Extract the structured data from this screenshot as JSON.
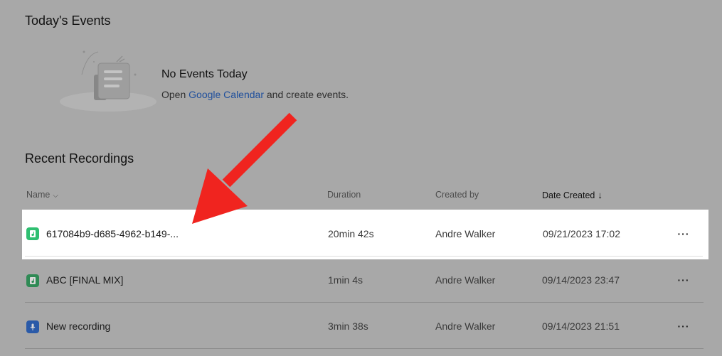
{
  "today": {
    "title": "Today's Events",
    "empty_title": "No Events Today",
    "empty_text_before": "Open ",
    "empty_link": "Google Calendar",
    "empty_text_after": " and create events."
  },
  "recent": {
    "title": "Recent Recordings",
    "columns": {
      "name": "Name",
      "duration": "Duration",
      "created_by": "Created by",
      "date_created": "Date Created"
    },
    "rows": [
      {
        "name": "617084b9-d685-4962-b149-...",
        "duration": "20min 42s",
        "created_by": "Andre Walker",
        "date": "09/21/2023 17:02",
        "icon": "audio-file-icon",
        "icon_color": "#2fbf71",
        "highlighted": true
      },
      {
        "name": "ABC [FINAL MIX]",
        "duration": "1min 4s",
        "created_by": "Andre Walker",
        "date": "09/14/2023 23:47",
        "icon": "audio-file-icon",
        "icon_color": "#2f8a55",
        "highlighted": false
      },
      {
        "name": "New recording",
        "duration": "3min 38s",
        "created_by": "Andre Walker",
        "date": "09/14/2023 21:51",
        "icon": "microphone-icon",
        "icon_color": "#2a5aa8",
        "highlighted": false
      }
    ]
  },
  "annotation": {
    "arrow_color": "#f0241f"
  }
}
